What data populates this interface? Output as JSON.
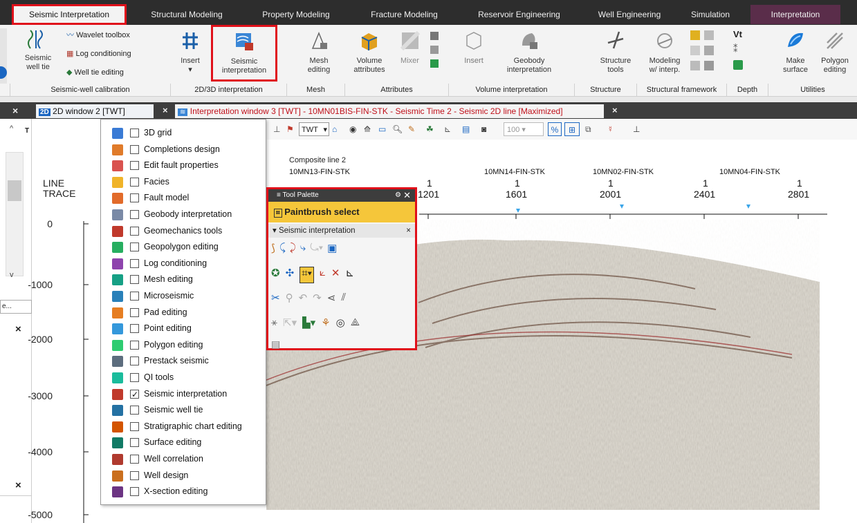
{
  "ribbon_tabs": [
    "Seismic Interpretation",
    "Structural Modeling",
    "Property Modeling",
    "Fracture Modeling",
    "Reservoir Engineering",
    "Well Engineering",
    "Simulation",
    "Interpretation"
  ],
  "ribbon": {
    "seismic_well_tie": "Seismic\nwell tie",
    "wavelet_toolbox": "Wavelet toolbox",
    "log_conditioning": "Log conditioning",
    "well_tie_editing": "Well tie editing",
    "insert": "Insert",
    "seismic_interpretation": "Seismic\ninterpretation",
    "mesh_editing": "Mesh\nediting",
    "volume_attributes": "Volume\nattributes",
    "mixer": "Mixer",
    "insert2": "Insert",
    "geobody_interpretation": "Geobody\ninterpretation",
    "structure_tools": "Structure\ntools",
    "modeling_interp": "Modeling\nw/ interp.",
    "make_surface": "Make\nsurface",
    "polygon_editing": "Polygon\nediting",
    "vt_label": "Vt",
    "groups": [
      "Seismic-well calibration",
      "2D/3D interpretation",
      "Mesh",
      "Attributes",
      "Volume interpretation",
      "Structure",
      "Structural framework",
      "Depth",
      "Utilities"
    ]
  },
  "window_tabs": {
    "tab1": "2D window 2 [TWT]",
    "tab2": "Interpretation window 3 [TWT] - 10MN01BIS-FIN-STK - Seismic Time 2 - Seismic 2D line [Maximized]"
  },
  "toolbar": {
    "domain": "TWT",
    "zoom": "100"
  },
  "plot": {
    "line_label": "LINE",
    "trace_label": "TRACE",
    "composite": "Composite line 2",
    "wells": [
      "10MN13-FIN-STK",
      "10MN14-FIN-STK",
      "10MN02-FIN-STK",
      "10MN04-FIN-STK"
    ],
    "x_ticks": [
      "1201",
      "1601",
      "2001",
      "2401",
      "2801"
    ],
    "x_line_ticks": [
      "1",
      "1",
      "1",
      "1",
      "1"
    ],
    "y_ticks": [
      "0",
      "-1000",
      "-2000",
      "-3000",
      "-4000",
      "-5000"
    ]
  },
  "plugin_menu": [
    {
      "label": "3D grid",
      "checked": false,
      "color": "#3a7bd5"
    },
    {
      "label": "Completions design",
      "checked": false,
      "color": "#e07b2a"
    },
    {
      "label": "Edit fault properties",
      "checked": false,
      "color": "#d9534f"
    },
    {
      "label": "Facies",
      "checked": false,
      "color": "#f0b429"
    },
    {
      "label": "Fault model",
      "checked": false,
      "color": "#e26b2a"
    },
    {
      "label": "Geobody interpretation",
      "checked": false,
      "color": "#7a8aa6"
    },
    {
      "label": "Geomechanics tools",
      "checked": false,
      "color": "#c0392b"
    },
    {
      "label": "Geopolygon editing",
      "checked": false,
      "color": "#27ae60"
    },
    {
      "label": "Log conditioning",
      "checked": false,
      "color": "#8e44ad"
    },
    {
      "label": "Mesh editing",
      "checked": false,
      "color": "#16a085"
    },
    {
      "label": "Microseismic",
      "checked": false,
      "color": "#2980b9"
    },
    {
      "label": "Pad editing",
      "checked": false,
      "color": "#e67e22"
    },
    {
      "label": "Point editing",
      "checked": false,
      "color": "#3498db"
    },
    {
      "label": "Polygon editing",
      "checked": false,
      "color": "#2ecc71"
    },
    {
      "label": "Prestack seismic",
      "checked": false,
      "color": "#5d6d7e"
    },
    {
      "label": "QI tools",
      "checked": false,
      "color": "#1abc9c"
    },
    {
      "label": "Seismic interpretation",
      "checked": true,
      "color": "#c0392b"
    },
    {
      "label": "Seismic well tie",
      "checked": false,
      "color": "#2471a3"
    },
    {
      "label": "Stratigraphic chart editing",
      "checked": false,
      "color": "#d35400"
    },
    {
      "label": "Surface editing",
      "checked": false,
      "color": "#117a65"
    },
    {
      "label": "Well correlation",
      "checked": false,
      "color": "#b03a2e"
    },
    {
      "label": "Well design",
      "checked": false,
      "color": "#ca6f1e"
    },
    {
      "label": "X-section editing",
      "checked": false,
      "color": "#6c3483"
    }
  ],
  "tool_palette": {
    "title": "Tool Palette",
    "selected_tool": "Paintbrush select",
    "section": "Seismic interpretation"
  },
  "side_panel": {
    "truncated": "e..."
  },
  "colors": {
    "accent": "#e0101a",
    "ribbon_bg": "#2d2d2d",
    "palette_header": "#f5c63a"
  }
}
